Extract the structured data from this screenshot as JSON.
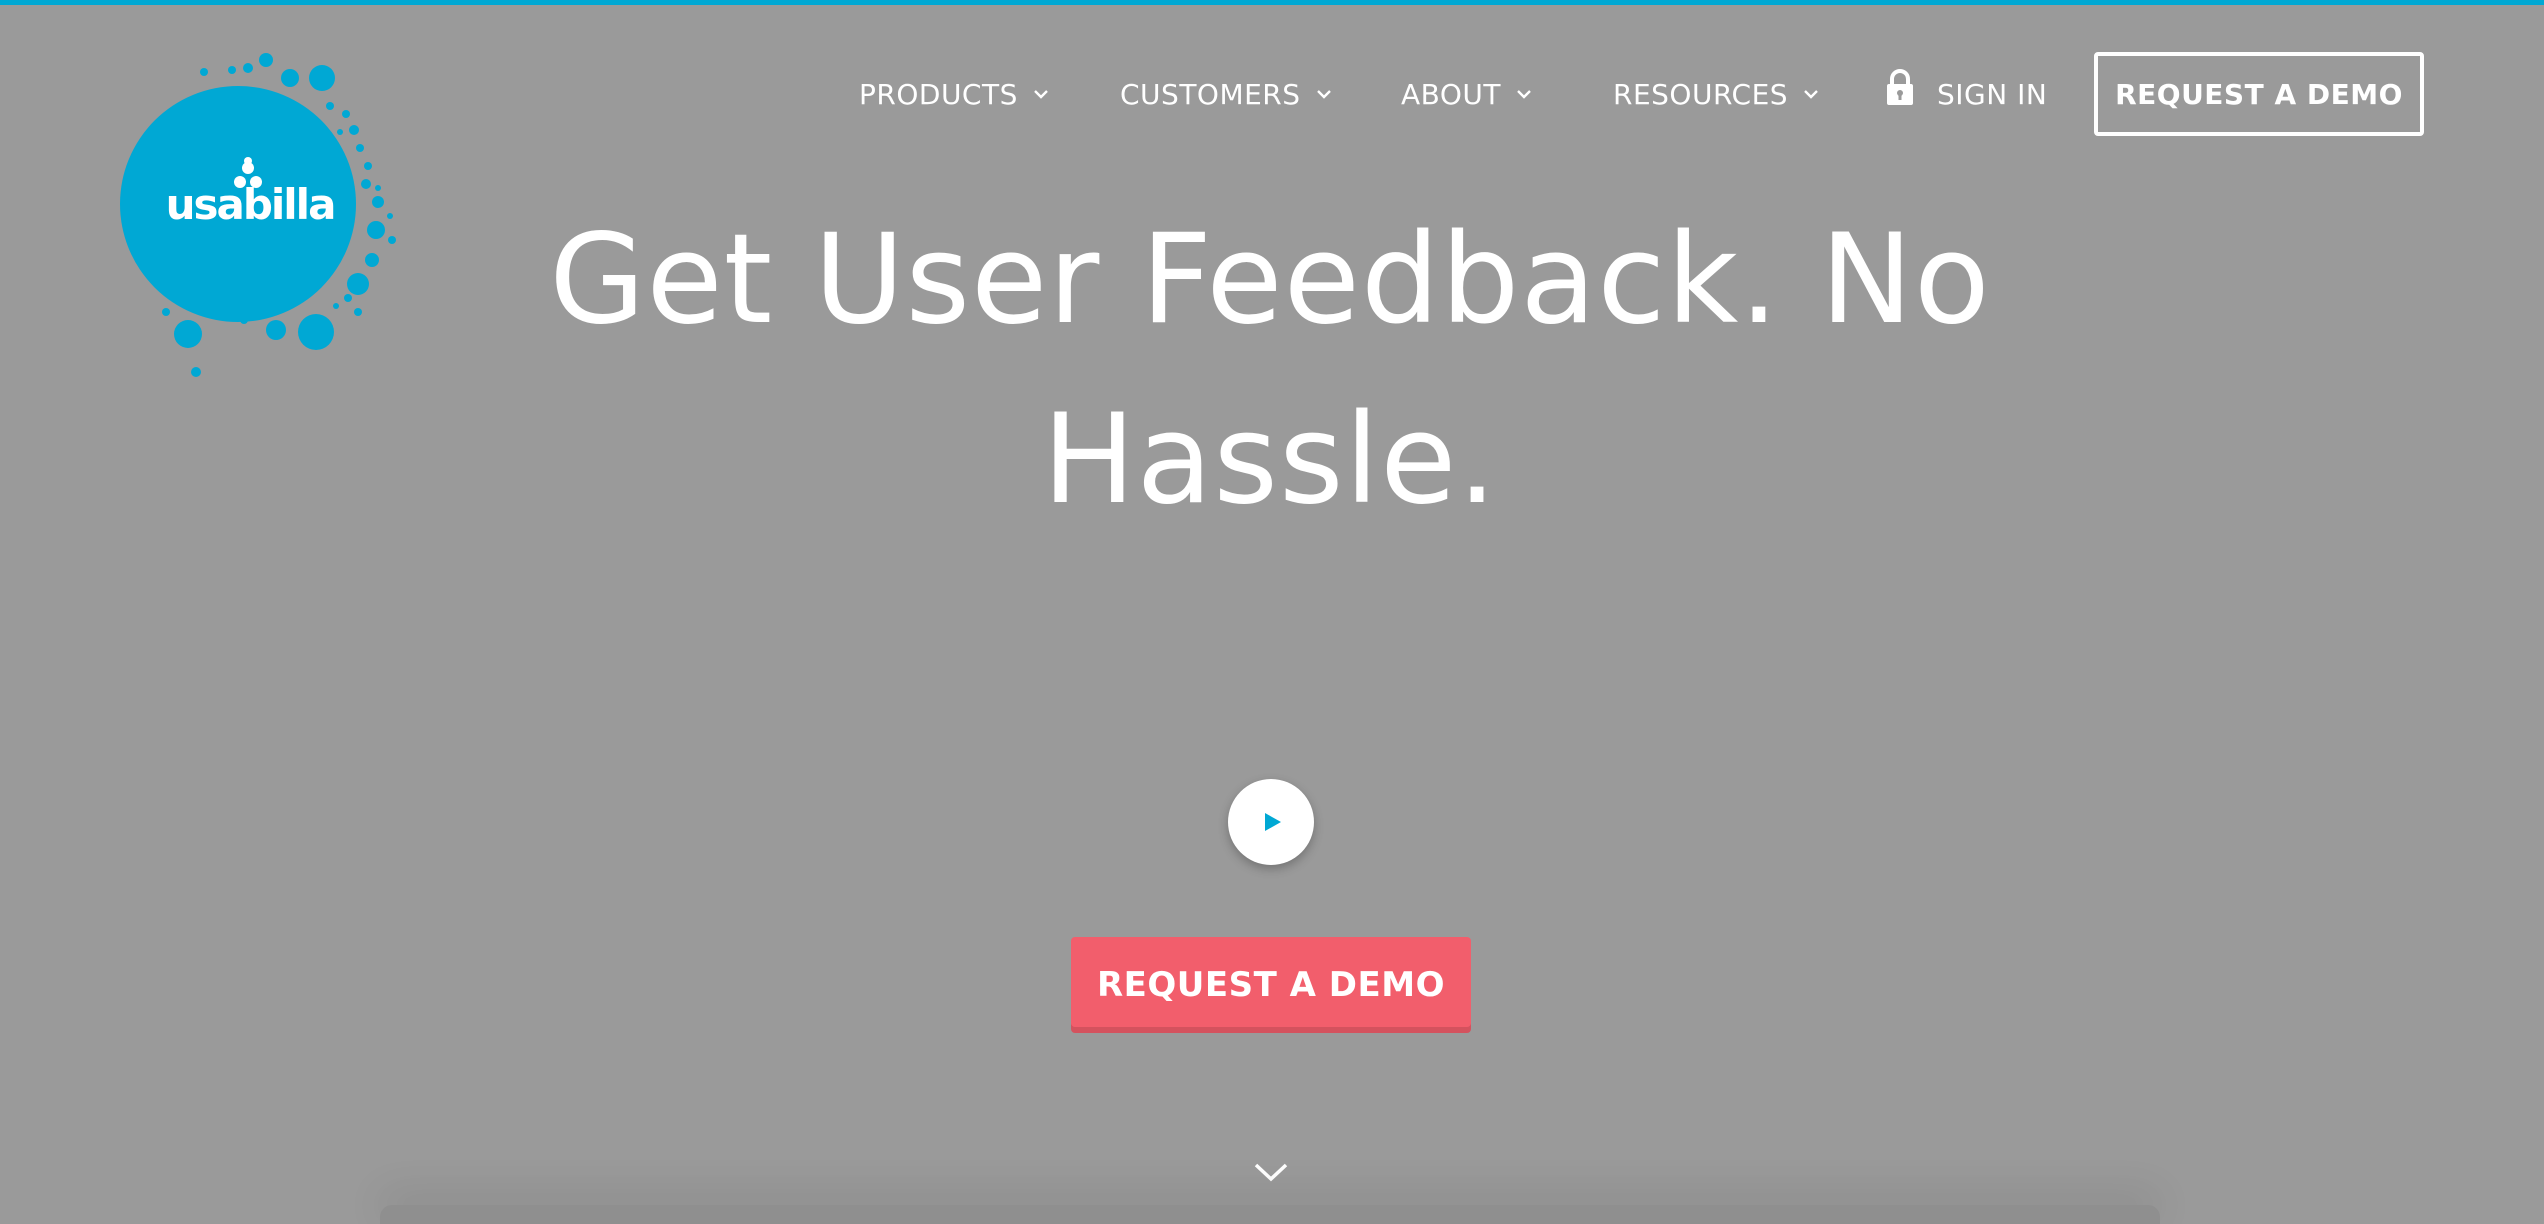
{
  "colors": {
    "accent": "#00a8d4",
    "cta": "#f25e6c",
    "background": "#9a9a9a",
    "text": "#ffffff"
  },
  "logo": {
    "text": "usabilla"
  },
  "nav": {
    "items": [
      {
        "label": "PRODUCTS",
        "icon": "chevron-down-icon"
      },
      {
        "label": "CUSTOMERS",
        "icon": "chevron-down-icon"
      },
      {
        "label": "ABOUT",
        "icon": "chevron-down-icon"
      },
      {
        "label": "RESOURCES",
        "icon": "chevron-down-icon"
      }
    ],
    "sign_in": {
      "label": "SIGN IN",
      "icon": "lock-icon"
    },
    "demo_label": "REQUEST A DEMO"
  },
  "hero": {
    "title": "Get User Feedback. No Hassle.",
    "play_icon": "play-icon",
    "cta_label": "REQUEST A DEMO",
    "scroll_icon": "chevron-down-icon"
  }
}
